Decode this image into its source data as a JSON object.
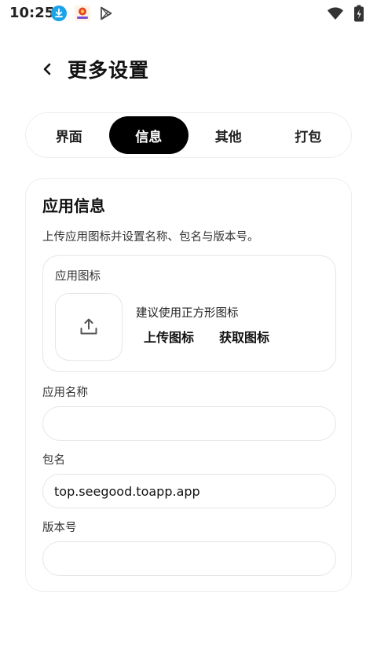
{
  "status_bar": {
    "time": "10:25",
    "left_icons": [
      "download-icon",
      "app-logo-icon",
      "play-store-icon"
    ],
    "right_icons": [
      "wifi-icon",
      "battery-icon"
    ]
  },
  "header": {
    "title": "更多设置"
  },
  "tabs": [
    {
      "label": "界面",
      "active": false
    },
    {
      "label": "信息",
      "active": true
    },
    {
      "label": "其他",
      "active": false
    },
    {
      "label": "打包",
      "active": false
    }
  ],
  "card": {
    "title": "应用信息",
    "description": "上传应用图标并设置名称、包名与版本号。",
    "icon_section": {
      "label": "应用图标",
      "hint": "建议使用正方形图标",
      "upload_label": "上传图标",
      "fetch_label": "获取图标"
    },
    "fields": {
      "app_name": {
        "label": "应用名称",
        "value": ""
      },
      "package_name": {
        "label": "包名",
        "value": "top.seegood.toapp.app"
      },
      "version": {
        "label": "版本号",
        "value": ""
      }
    }
  },
  "colors": {
    "accent": "#000000",
    "border": "#e6e6e6",
    "download_badge": "#1aa3e8"
  }
}
